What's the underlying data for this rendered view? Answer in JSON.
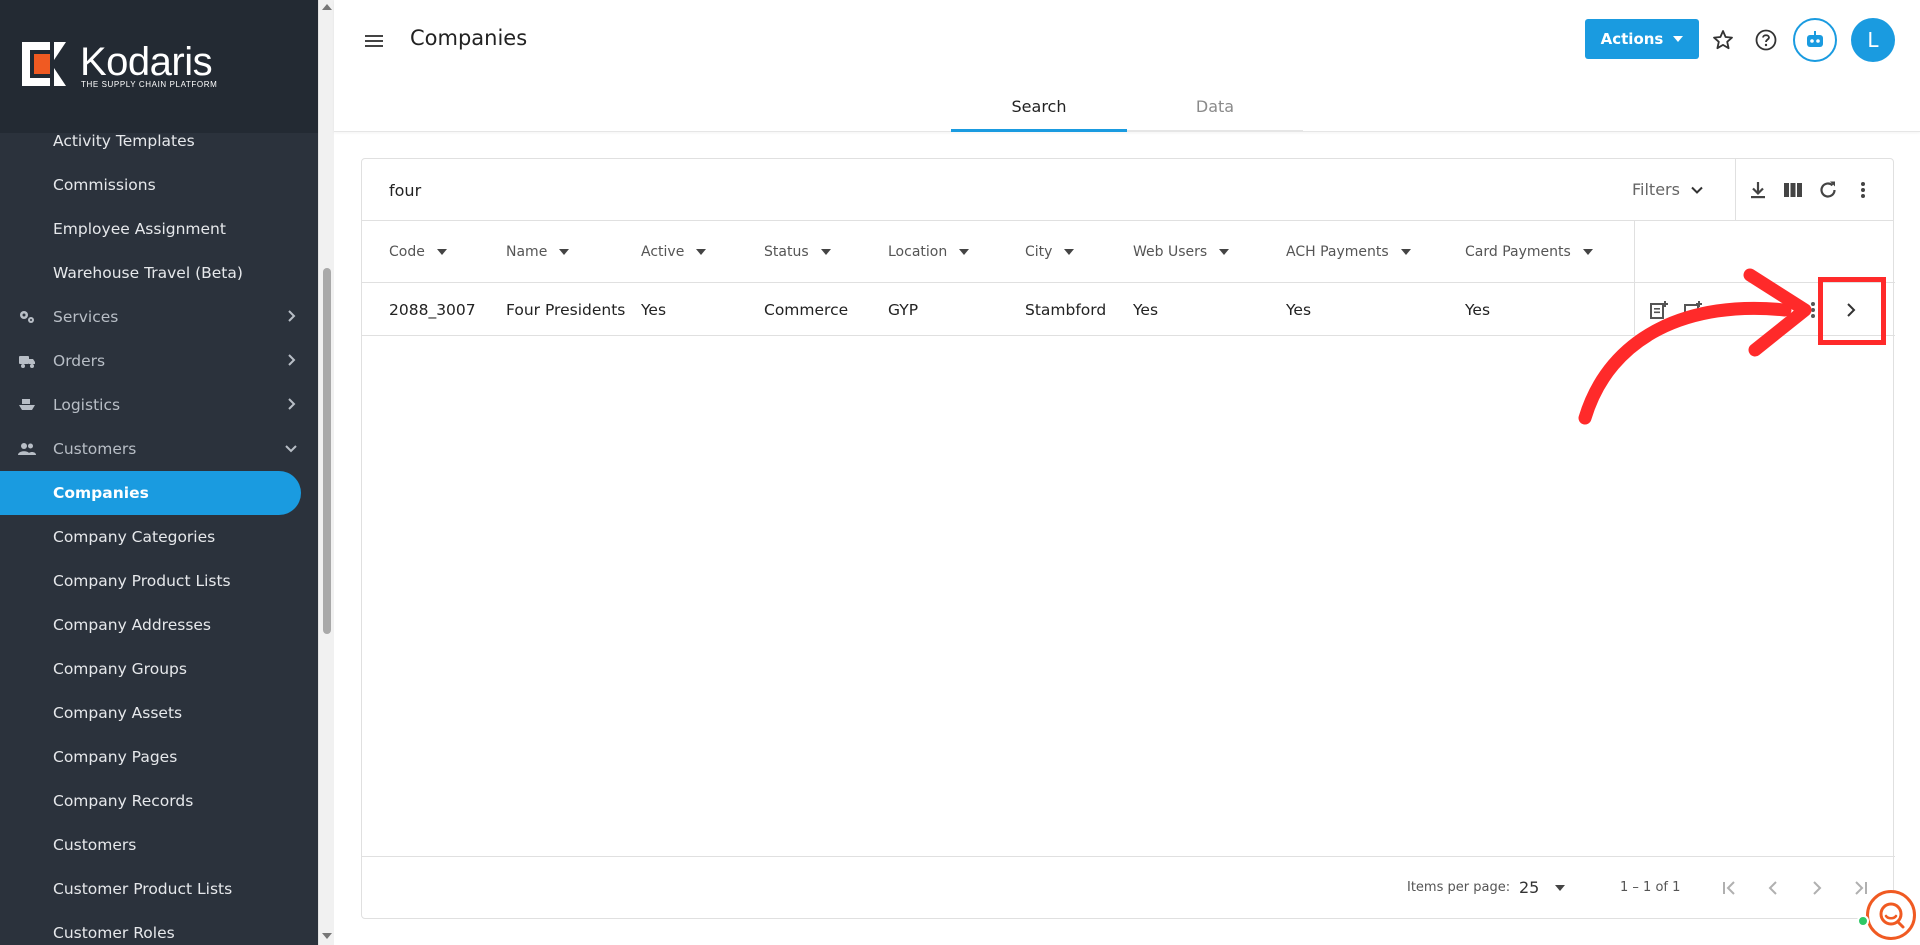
{
  "brand": {
    "name": "Kodaris",
    "tagline": "THE SUPPLY CHAIN PLATFORM",
    "accent_color": "#1a9be0",
    "logo_orange": "#f05a22"
  },
  "sidebar": {
    "items": [
      {
        "label": "Activity Templates",
        "type": "sub"
      },
      {
        "label": "Commissions",
        "type": "sub"
      },
      {
        "label": "Employee Assignment",
        "type": "sub"
      },
      {
        "label": "Warehouse Travel (Beta)",
        "type": "sub"
      },
      {
        "label": "Services",
        "type": "section",
        "icon": "gears-icon",
        "chevron": "chevron-right-icon"
      },
      {
        "label": "Orders",
        "type": "section",
        "icon": "truck-icon",
        "chevron": "chevron-right-icon"
      },
      {
        "label": "Logistics",
        "type": "section",
        "icon": "ship-icon",
        "chevron": "chevron-right-icon"
      },
      {
        "label": "Customers",
        "type": "section",
        "icon": "people-icon",
        "chevron": "chevron-down-icon"
      },
      {
        "label": "Companies",
        "type": "sub",
        "active": true
      },
      {
        "label": "Company Categories",
        "type": "sub"
      },
      {
        "label": "Company Product Lists",
        "type": "sub"
      },
      {
        "label": "Company Addresses",
        "type": "sub"
      },
      {
        "label": "Company Groups",
        "type": "sub"
      },
      {
        "label": "Company Assets",
        "type": "sub"
      },
      {
        "label": "Company Pages",
        "type": "sub"
      },
      {
        "label": "Company Records",
        "type": "sub"
      },
      {
        "label": "Customers",
        "type": "sub"
      },
      {
        "label": "Customer Product Lists",
        "type": "sub"
      },
      {
        "label": "Customer Roles",
        "type": "sub"
      }
    ]
  },
  "header": {
    "title": "Companies",
    "actions_label": "Actions",
    "avatar_initial": "L",
    "icons": [
      "menu-icon",
      "star-icon",
      "help-icon",
      "robot-icon"
    ]
  },
  "tabs": [
    {
      "label": "Search",
      "active": true
    },
    {
      "label": "Data",
      "active": false
    }
  ],
  "search": {
    "value": "four",
    "filters_label": "Filters",
    "toolbar_icons": [
      "download-icon",
      "columns-icon",
      "refresh-icon",
      "more-vert-icon"
    ]
  },
  "table": {
    "columns": [
      "Code",
      "Name",
      "Active",
      "Status",
      "Location",
      "City",
      "Web Users",
      "ACH Payments",
      "Card Payments"
    ],
    "rows": [
      [
        "2088_3007",
        "Four Presidents",
        "Yes",
        "Commerce",
        "GYP",
        "Stambford",
        "Yes",
        "Yes",
        "Yes"
      ]
    ],
    "row_action_icons": [
      "note-add-icon",
      "edit-image-icon",
      "video-icon",
      "more-vert-icon",
      "chevron-right-icon"
    ]
  },
  "pagination": {
    "items_per_page_label": "Items per page:",
    "items_per_page": "25",
    "range": "1 – 1 of 1"
  },
  "annotation": {
    "color": "#ff2a2a"
  }
}
